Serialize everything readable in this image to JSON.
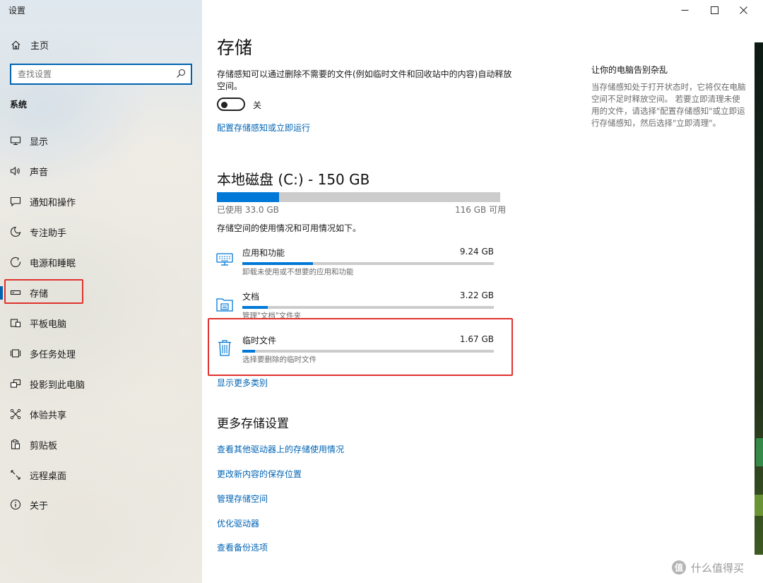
{
  "window": {
    "title": "设置",
    "controls": {
      "minimize": "minimize-icon",
      "maximize": "maximize-icon",
      "close": "close-icon"
    }
  },
  "sidebar": {
    "home_label": "主页",
    "search": {
      "placeholder": "查找设置"
    },
    "section_label": "系统",
    "items": [
      {
        "label": "显示",
        "icon": "display-icon"
      },
      {
        "label": "声音",
        "icon": "sound-icon"
      },
      {
        "label": "通知和操作",
        "icon": "notification-icon"
      },
      {
        "label": "专注助手",
        "icon": "focus-assist-icon"
      },
      {
        "label": "电源和睡眠",
        "icon": "power-icon"
      },
      {
        "label": "存储",
        "icon": "storage-icon",
        "selected": true
      },
      {
        "label": "平板电脑",
        "icon": "tablet-icon"
      },
      {
        "label": "多任务处理",
        "icon": "multitasking-icon"
      },
      {
        "label": "投影到此电脑",
        "icon": "projecting-icon"
      },
      {
        "label": "体验共享",
        "icon": "shared-experiences-icon"
      },
      {
        "label": "剪贴板",
        "icon": "clipboard-icon"
      },
      {
        "label": "远程桌面",
        "icon": "remote-desktop-icon"
      },
      {
        "label": "关于",
        "icon": "info-icon"
      }
    ]
  },
  "main": {
    "title": "存储",
    "storage_sense": {
      "description": "存储感知可以通过删除不需要的文件(例如临时文件和回收站中的内容)自动释放空间。",
      "toggle_state": "关",
      "toggle_on": false,
      "configure_link": "配置存储感知或立即运行"
    },
    "disk": {
      "title": "本地磁盘 (C:) - 150 GB",
      "used_label": "已使用 33.0 GB",
      "free_label": "116 GB 可用",
      "used_fraction": 0.22,
      "usage_description": "存储空间的使用情况和可用情况如下。"
    },
    "categories": [
      {
        "name": "应用和功能",
        "size": "9.24 GB",
        "description": "卸载未使用或不想要的应用和功能",
        "fraction": 0.28,
        "icon": "apps-icon"
      },
      {
        "name": "文档",
        "size": "3.22 GB",
        "description": "管理\"文档\"文件夹",
        "fraction": 0.1,
        "icon": "documents-folder-icon"
      },
      {
        "name": "临时文件",
        "size": "1.67 GB",
        "description": "选择要删除的临时文件",
        "fraction": 0.05,
        "icon": "trash-icon",
        "highlighted": true
      }
    ],
    "show_more_link": "显示更多类别",
    "more_settings": {
      "title": "更多存储设置",
      "links": [
        "查看其他驱动器上的存储使用情况",
        "更改新内容的保存位置",
        "管理存储空间",
        "优化驱动器",
        "查看备份选项"
      ]
    },
    "side_panel": {
      "title": "让你的电脑告别杂乱",
      "text": "当存储感知处于打开状态时，它将仅在电脑空间不足时释放空间。 若要立即清理未使用的文件，请选择\"配置存储感知\"或立即运行存储感知，然后选择\"立即清理\"。"
    }
  },
  "watermark": {
    "text": "什么值得买",
    "icon": "smzdm-logo-icon"
  },
  "colors": {
    "accent": "#0078d7",
    "link": "#0064b5",
    "highlight_border": "#e0322e"
  }
}
